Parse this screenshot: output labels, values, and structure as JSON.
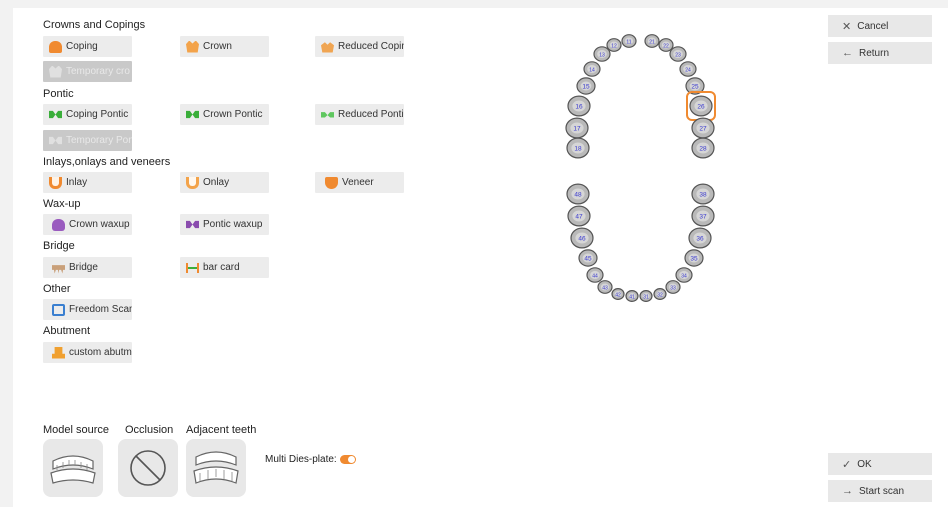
{
  "sections": {
    "crowns": "Crowns and Copings",
    "pontic": "Pontic",
    "inlays": "Inlays,onlays and veneers",
    "waxup": "Wax-up",
    "bridge": "Bridge",
    "other": "Other",
    "abutment": "Abutment"
  },
  "buttons": {
    "coping": "Coping",
    "crown": "Crown",
    "reduced_coping": "Reduced Copin",
    "temporary_crown": "Temporary cro",
    "coping_pontic": "Coping Pontic",
    "crown_pontic": "Crown Pontic",
    "reduced_pontic": "Reduced Pontic",
    "temporary_pontic": "Temporary Pon",
    "inlay": "Inlay",
    "onlay": "Onlay",
    "veneer": "Veneer",
    "crown_waxup": "Crown waxup",
    "pontic_waxup": "Pontic waxup",
    "bridge": "Bridge",
    "bar_card": "bar card",
    "freedom_scan": "Freedom Scan",
    "custom_abutment": "custom abutme"
  },
  "side": {
    "cancel": "Cancel",
    "return": "Return",
    "ok": "OK",
    "start_scan": "Start scan"
  },
  "bottom": {
    "model_source": "Model source",
    "occlusion": "Occlusion",
    "adjacent_teeth": "Adjacent teeth",
    "multi_dies": "Multi Dies-plate:",
    "multi_dies_enabled": true
  },
  "teeth": {
    "selected": "26",
    "upper_labels": [
      "18",
      "17",
      "16",
      "15",
      "14",
      "13",
      "12",
      "11",
      "21",
      "22",
      "23",
      "24",
      "25",
      "26",
      "27",
      "28"
    ],
    "lower_labels": [
      "48",
      "47",
      "46",
      "45",
      "44",
      "43",
      "42",
      "41",
      "31",
      "32",
      "33",
      "34",
      "35",
      "36",
      "37",
      "38"
    ]
  },
  "colors": {
    "accent": "#f08a30",
    "tooth_number": "#3b3bd0",
    "button_bg": "#ececec",
    "disabled_bg": "#c9c9c9"
  }
}
